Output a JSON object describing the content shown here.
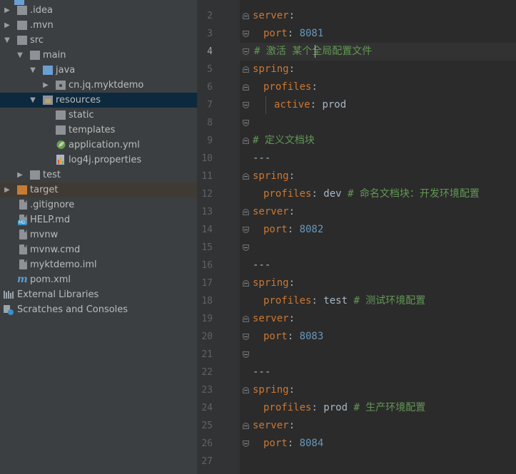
{
  "project_tree": {
    "items": [
      {
        "label": ".idea"
      },
      {
        "label": ".mvn"
      },
      {
        "label": "src"
      },
      {
        "label": "main"
      },
      {
        "label": "java"
      },
      {
        "label": "cn.jq.myktdemo"
      },
      {
        "label": "resources"
      },
      {
        "label": "static"
      },
      {
        "label": "templates"
      },
      {
        "label": "application.yml"
      },
      {
        "label": "log4j.properties"
      },
      {
        "label": "test"
      },
      {
        "label": "target"
      },
      {
        "label": ".gitignore"
      },
      {
        "label": "HELP.md"
      },
      {
        "label": "mvnw"
      },
      {
        "label": "mvnw.cmd"
      },
      {
        "label": "myktdemo.iml"
      },
      {
        "label": "pom.xml"
      },
      {
        "label": "External Libraries"
      },
      {
        "label": "Scratches and Consoles"
      }
    ]
  },
  "editor": {
    "current_line": 4,
    "line_numbers": [
      "2",
      "3",
      "4",
      "5",
      "6",
      "7",
      "8",
      "9",
      "10",
      "11",
      "12",
      "13",
      "14",
      "15",
      "16",
      "17",
      "18",
      "19",
      "20",
      "21",
      "22",
      "23",
      "24",
      "25",
      "26",
      "27"
    ],
    "lines": [
      {
        "key": "server",
        "colon": ":"
      },
      {
        "key": "port",
        "colon": ": ",
        "num": "8081"
      },
      {
        "comment": "# 激活 某个全局配置文件"
      },
      {
        "key": "spring",
        "colon": ":"
      },
      {
        "key": "profiles",
        "colon": ":"
      },
      {
        "key": "active",
        "colon": ": ",
        "value": "prod"
      },
      {},
      {
        "comment": "# 定义文档块"
      },
      {
        "text": "---"
      },
      {
        "key": "spring",
        "colon": ":"
      },
      {
        "key": "profiles",
        "colon": ": ",
        "value": "dev ",
        "comment": "# 命名文档块：开发环境配置"
      },
      {
        "key": "server",
        "colon": ":"
      },
      {
        "key": "port",
        "colon": ": ",
        "num": "8082"
      },
      {},
      {
        "text": "---"
      },
      {
        "key": "spring",
        "colon": ":"
      },
      {
        "key": "profiles",
        "colon": ": ",
        "value": "test ",
        "comment": "# 测试环境配置"
      },
      {
        "key": "server",
        "colon": ":"
      },
      {
        "key": "port",
        "colon": ": ",
        "num": "8083"
      },
      {},
      {
        "text": "---"
      },
      {
        "key": "spring",
        "colon": ":"
      },
      {
        "key": "profiles",
        "colon": ": ",
        "value": "prod ",
        "comment": "# 生产环境配置"
      },
      {
        "key": "server",
        "colon": ":"
      },
      {
        "key": "port",
        "colon": ": ",
        "num": "8084"
      },
      {}
    ]
  },
  "colors": {
    "tree_bg": "#3c3f41",
    "editor_bg": "#2b2b2b",
    "gutter_bg": "#313335",
    "keyword": "#cc7832",
    "number": "#6897bb",
    "comment": "#629755",
    "selection": "#0d293e",
    "excluded_folder": "#c57c35"
  }
}
